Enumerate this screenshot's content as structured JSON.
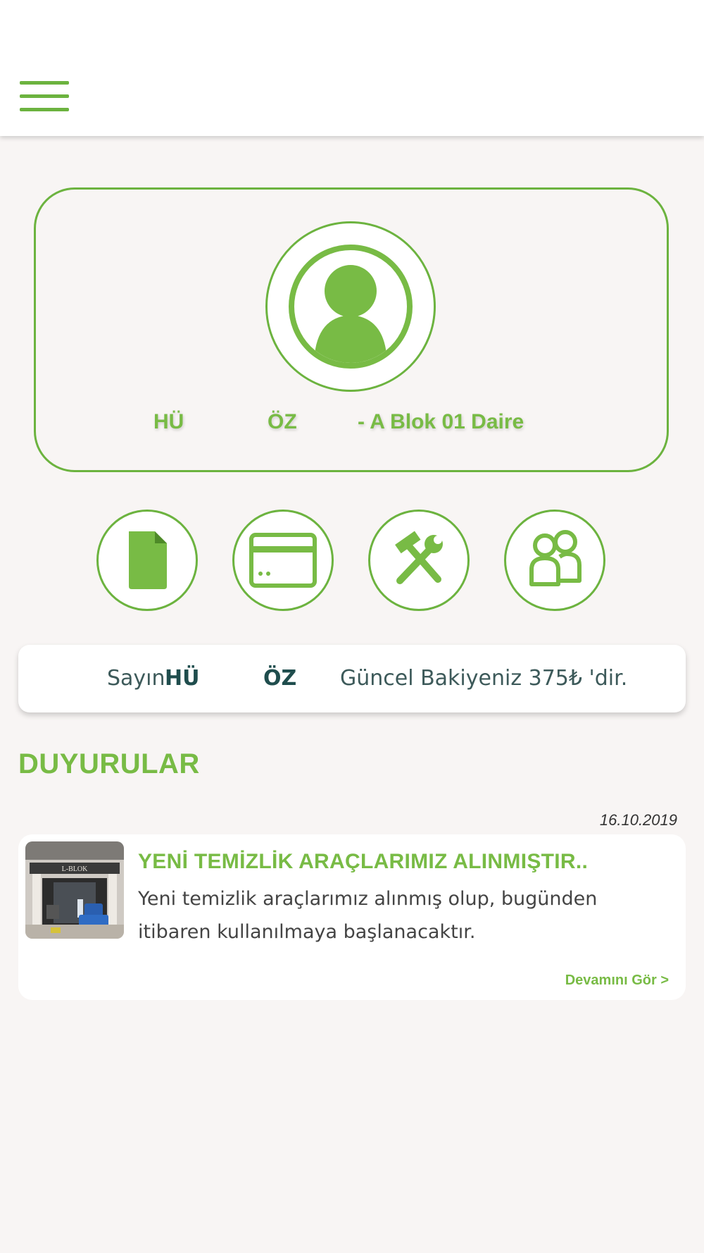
{
  "header": {
    "menu_icon": "hamburger-menu-icon"
  },
  "profile": {
    "avatar_icon": "user-avatar-icon",
    "name_first": "HÜ",
    "name_last": "ÖZ",
    "unit": "- A Blok 01 Daire"
  },
  "actions": [
    {
      "icon": "document-icon"
    },
    {
      "icon": "credit-card-icon"
    },
    {
      "icon": "tools-icon"
    },
    {
      "icon": "users-icon"
    }
  ],
  "balance": {
    "prefix": "Sayın",
    "name_first": "HÜ",
    "name_last": "ÖZ",
    "text": "Güncel Bakiyeniz 375₺ 'dir."
  },
  "announcements": {
    "title": "DUYURULAR",
    "items": [
      {
        "date": "16.10.2019",
        "headline": "YENİ TEMİZLİK ARAÇLARIMIZ ALINMIŞTIR..",
        "body": "Yeni temizlik araçlarımız alınmış olup, bugünden itibaren kullanılmaya başlanacaktır.",
        "more_label": "Devamını Gör >",
        "sign_text": "L-BLOK"
      }
    ]
  },
  "colors": {
    "accent": "#78bb45",
    "accent_border": "#6cb33f",
    "background": "#f8f5f4",
    "text_dark": "#1f4d4d"
  }
}
